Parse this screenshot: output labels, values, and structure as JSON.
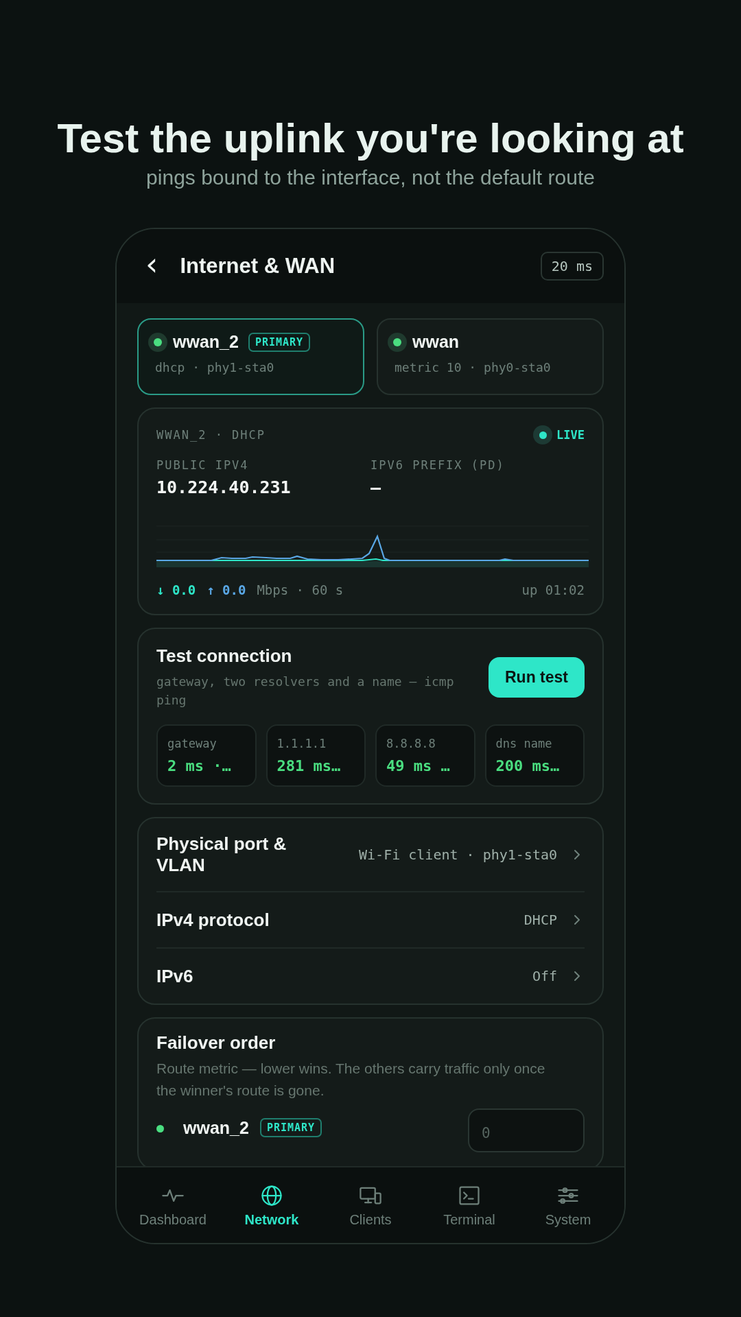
{
  "heading": {
    "title": "Test the uplink you're looking at",
    "subtitle": "pings bound to the interface, not the default route"
  },
  "header": {
    "back": "‹",
    "title": "Internet & WAN",
    "latency": "20 ms"
  },
  "interfaces": [
    {
      "name": "wwan_2",
      "badge": "PRIMARY",
      "detail": "dhcp · phy1-sta0",
      "selected": true,
      "color": "#4ade80"
    },
    {
      "name": "wwan",
      "detail": "metric 10 · phy0-sta0",
      "selected": false,
      "color": "#4ade80"
    }
  ],
  "status": {
    "caption": "WWAN_2 · DHCP",
    "live": "LIVE",
    "fields": [
      {
        "label": "PUBLIC IPV4",
        "value": "10.224.40.231"
      },
      {
        "label": "IPV6 PREFIX (PD)",
        "value": "–"
      }
    ],
    "down_arrow": "↓",
    "down": "0.0",
    "up_arrow": "↑",
    "up": "0.0",
    "unit": "Mbps · 60 s",
    "uptime": "up 01:02"
  },
  "test": {
    "title": "Test connection",
    "description": "gateway, two resolvers and a name — icmp ping",
    "button": "Run test",
    "results": [
      {
        "label": "gateway",
        "value": "2 ms ·…"
      },
      {
        "label": "1.1.1.1",
        "value": "281 ms…"
      },
      {
        "label": "8.8.8.8",
        "value": "49 ms …"
      },
      {
        "label": "dns name",
        "value": "200 ms…"
      }
    ]
  },
  "settings": [
    {
      "label": "Physical port & VLAN",
      "value": "Wi-Fi client · phy1-sta0"
    },
    {
      "label": "IPv4 protocol",
      "value": "DHCP"
    },
    {
      "label": "IPv6",
      "value": "Off"
    }
  ],
  "failover": {
    "title": "Failover order",
    "description": "Route metric — lower wins. The others carry traffic only once the winner's route is gone.",
    "rows": [
      {
        "name": "wwan_2",
        "badge": "PRIMARY",
        "color": "#4ade80",
        "metric": "0"
      }
    ]
  },
  "nav": [
    {
      "label": "Dashboard",
      "kind": "pulse",
      "selected": false
    },
    {
      "label": "Network",
      "kind": "globe",
      "selected": true
    },
    {
      "label": "Clients",
      "kind": "devices",
      "selected": false
    },
    {
      "label": "Terminal",
      "kind": "terminal",
      "selected": false
    },
    {
      "label": "System",
      "kind": "sliders",
      "selected": false
    }
  ]
}
